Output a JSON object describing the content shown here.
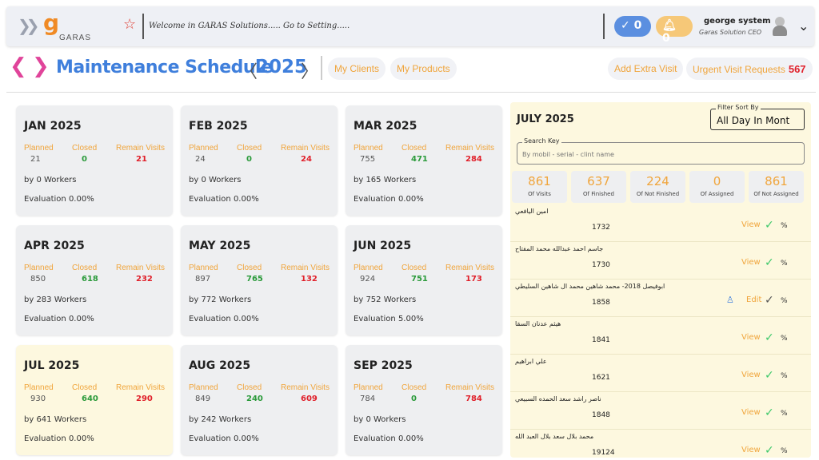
{
  "topbar": {
    "logo_text": "GARAS",
    "welcome": "Welcome in GARAS Solutions..... Go to Setting.....",
    "checks_count": "0",
    "notifications_count": "0",
    "user_name": "george system",
    "user_role": "Garas Solution CEO"
  },
  "header": {
    "title": "Maintenance Schedule",
    "year": "2025",
    "my_clients": "My Clients",
    "my_products": "My Products",
    "add_extra_visit": "Add Extra Visit",
    "urgent_label": "Urgent Visit Requests",
    "urgent_count": "567"
  },
  "labels": {
    "planned": "Planned",
    "closed": "Closed",
    "remain": "Remain Visits"
  },
  "months": [
    {
      "name": "JAN 2025",
      "planned": "21",
      "closed": "0",
      "remain": "21",
      "workers": "by 0 Workers",
      "evaluation": "Evaluation 0.00%"
    },
    {
      "name": "FEB 2025",
      "planned": "24",
      "closed": "0",
      "remain": "24",
      "workers": "by 0 Workers",
      "evaluation": "Evaluation 0.00%"
    },
    {
      "name": "MAR 2025",
      "planned": "755",
      "closed": "471",
      "remain": "284",
      "workers": "by 165 Workers",
      "evaluation": "Evaluation 0.00%"
    },
    {
      "name": "APR 2025",
      "planned": "850",
      "closed": "618",
      "remain": "232",
      "workers": "by 283 Workers",
      "evaluation": "Evaluation 0.00%"
    },
    {
      "name": "MAY 2025",
      "planned": "897",
      "closed": "765",
      "remain": "132",
      "workers": "by 772 Workers",
      "evaluation": "Evaluation 0.00%"
    },
    {
      "name": "JUN 2025",
      "planned": "924",
      "closed": "751",
      "remain": "173",
      "workers": "by 752 Workers",
      "evaluation": "Evaluation 5.00%"
    },
    {
      "name": "JUL 2025",
      "planned": "930",
      "closed": "640",
      "remain": "290",
      "workers": "by 641 Workers",
      "evaluation": "Evaluation 0.00%"
    },
    {
      "name": "AUG 2025",
      "planned": "849",
      "closed": "240",
      "remain": "609",
      "workers": "by 242 Workers",
      "evaluation": "Evaluation 0.00%"
    },
    {
      "name": "SEP 2025",
      "planned": "784",
      "closed": "0",
      "remain": "784",
      "workers": "by 0 Workers",
      "evaluation": "Evaluation 0.00%"
    }
  ],
  "panel": {
    "title": "JULY 2025",
    "filter_legend": "Filter Sort By",
    "filter_value": "All Day In Mont",
    "search_legend": "Search Key",
    "search_placeholder": "By mobil - serial - clint name",
    "stats": [
      {
        "value": "861",
        "caption": "Of Visits"
      },
      {
        "value": "637",
        "caption": "Of Finished"
      },
      {
        "value": "224",
        "caption": "Of Not Finished"
      },
      {
        "value": "0",
        "caption": "Of Assigned"
      },
      {
        "value": "861",
        "caption": "Of Not Assigned"
      }
    ],
    "rows": [
      {
        "name": "امين اليافعي",
        "code": "1732",
        "action": "View",
        "pct": "%"
      },
      {
        "name": "جاسم احمد عبدالله محمد المفتاح",
        "code": "1730",
        "action": "View",
        "pct": "%"
      },
      {
        "name": "ابوفيصل 2018-  محمد شاهين محمد ال شاهين السليطي",
        "code": "1858",
        "action": "Edit",
        "pct": "%"
      },
      {
        "name": "هيثم عدنان السقا",
        "code": "1841",
        "action": "View",
        "pct": "%"
      },
      {
        "name": "علي ابراهيم",
        "code": "1621",
        "action": "View",
        "pct": "%"
      },
      {
        "name": "ناصر راشد سعد الحمده السبيعي",
        "code": "1848",
        "action": "View",
        "pct": "%"
      },
      {
        "name": "محمد  بلال سعد بلال العبد الله",
        "code": "19124",
        "action": "View",
        "pct": "%"
      }
    ]
  },
  "colors": {
    "accent_blue": "#3f7fdc",
    "accent_pink": "#e0449a",
    "orange": "#f0a53c",
    "green": "#2a9a3a",
    "red": "#e0202a"
  }
}
